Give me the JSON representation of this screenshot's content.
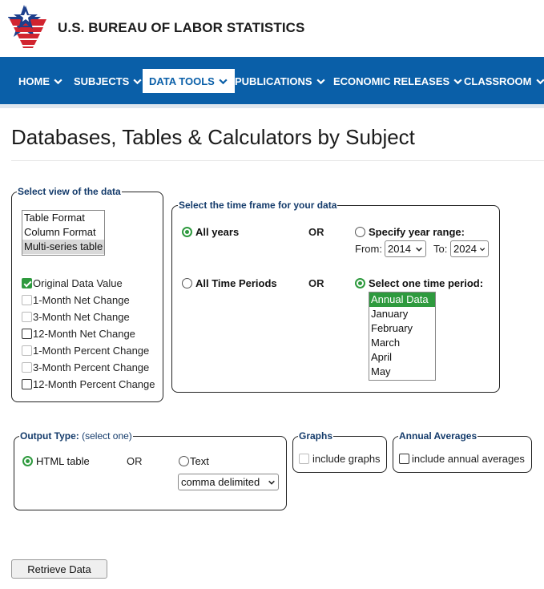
{
  "header": {
    "org_name": "U.S. BUREAU OF LABOR STATISTICS"
  },
  "nav": {
    "items": [
      {
        "label": "HOME"
      },
      {
        "label": "SUBJECTS"
      },
      {
        "label": "DATA TOOLS"
      },
      {
        "label": "PUBLICATIONS"
      },
      {
        "label": "ECONOMIC RELEASES"
      },
      {
        "label": "CLASSROOM"
      }
    ]
  },
  "page": {
    "title": "Databases, Tables & Calculators by Subject"
  },
  "view_panel": {
    "legend": "Select view of the data",
    "formats": [
      "Table Format",
      "Column Format",
      "Multi-series table"
    ],
    "checkboxes": [
      {
        "label": "Original Data Value",
        "checked": true
      },
      {
        "label": "1-Month Net Change"
      },
      {
        "label": "3-Month Net Change"
      },
      {
        "label": "12-Month Net Change"
      },
      {
        "label": "1-Month Percent Change"
      },
      {
        "label": "3-Month Percent Change"
      },
      {
        "label": "12-Month Percent Change"
      }
    ]
  },
  "time_panel": {
    "legend": "Select the time frame for your data",
    "all_years": "All years",
    "or": "OR",
    "specify_range": "Specify year range:",
    "from_label": "From:",
    "from_value": "2014",
    "to_label": "To:",
    "to_value": "2024",
    "all_periods": "All Time Periods",
    "one_period": "Select one time period:",
    "periods": [
      "Annual Data",
      "January",
      "February",
      "March",
      "April",
      "May"
    ]
  },
  "output_panel": {
    "legend": "Output Type:",
    "legend_note": "(select one)",
    "html_table": "HTML table",
    "or": "OR",
    "text": "Text",
    "delimiter": "comma delimited"
  },
  "graphs_panel": {
    "legend": "Graphs",
    "label": "include graphs"
  },
  "annual_panel": {
    "legend": "Annual Averages",
    "label": "include annual averages"
  },
  "actions": {
    "retrieve": "Retrieve Data"
  },
  "colors": {
    "nav_bg": "#0a5fa8",
    "accent_green": "#2e9a3e",
    "legend_text": "#143b6b",
    "logo_red": "#d1242f",
    "logo_blue": "#1d3f8c"
  }
}
